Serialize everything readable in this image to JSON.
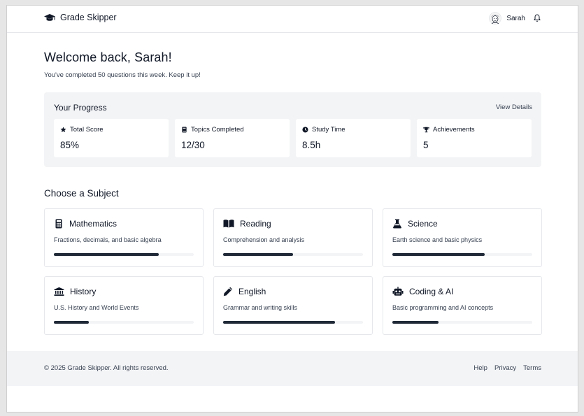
{
  "header": {
    "brand_name": "Grade Skipper",
    "user_name": "Sarah"
  },
  "welcome": {
    "title": "Welcome back, Sarah!",
    "subtitle": "You've completed 50 questions this week. Keep it up!"
  },
  "progress": {
    "title": "Your Progress",
    "view_details": "View Details",
    "stats": [
      {
        "label": "Total Score",
        "value": "85%",
        "icon": "star-icon"
      },
      {
        "label": "Topics Completed",
        "value": "12/30",
        "icon": "book-icon"
      },
      {
        "label": "Study Time",
        "value": "8.5h",
        "icon": "clock-icon"
      },
      {
        "label": "Achievements",
        "value": "5",
        "icon": "trophy-icon"
      }
    ]
  },
  "subjects": {
    "title": "Choose a Subject",
    "items": [
      {
        "name": "Mathematics",
        "desc": "Fractions, decimals, and basic algebra",
        "progress": 0.75,
        "icon": "calculator-icon"
      },
      {
        "name": "Reading",
        "desc": "Comprehension and analysis",
        "progress": 0.5,
        "icon": "open-book-icon"
      },
      {
        "name": "Science",
        "desc": "Earth science and basic physics",
        "progress": 0.66,
        "icon": "flask-icon"
      },
      {
        "name": "History",
        "desc": "U.S. History and World Events",
        "progress": 0.25,
        "icon": "landmark-icon"
      },
      {
        "name": "English",
        "desc": "Grammar and writing skills",
        "progress": 0.8,
        "icon": "pencil-icon"
      },
      {
        "name": "Coding & AI",
        "desc": "Basic programming and AI concepts",
        "progress": 0.33,
        "icon": "robot-icon"
      }
    ]
  },
  "footer": {
    "copyright": "© 2025 Grade Skipper. All rights reserved.",
    "links": [
      "Help",
      "Privacy",
      "Terms"
    ]
  },
  "colors": {
    "accent": "#1f2937",
    "panel_bg": "#f3f4f6",
    "border": "#e5e7eb"
  }
}
